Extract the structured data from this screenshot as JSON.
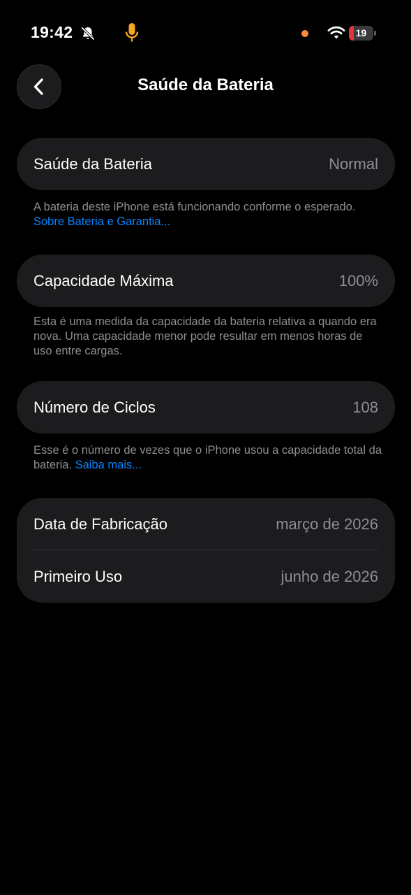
{
  "status_bar": {
    "time": "19:42",
    "battery_level": "19",
    "battery_fraction": 0.19,
    "colors": {
      "mic": "#f5a623",
      "dot": "#ff8a3d",
      "battery_low": "#e0353b"
    },
    "icons": [
      "bell-slash-icon",
      "microphone-icon",
      "wifi-icon",
      "battery-icon"
    ]
  },
  "nav": {
    "title": "Saúde da Bateria",
    "back_icon": "chevron-left-icon"
  },
  "health": {
    "label": "Saúde da Bateria",
    "value": "Normal",
    "footnote_text": "A bateria deste iPhone está funcionando conforme o esperado. ",
    "footnote_link": "Sobre Bateria e Garantia..."
  },
  "capacity": {
    "label": "Capacidade Máxima",
    "value": "100%",
    "footnote_text": "Esta é uma medida da capacidade da bateria relativa a quando era nova. Uma capacidade menor pode resultar em menos horas de uso entre cargas."
  },
  "cycles": {
    "label": "Número de Ciclos",
    "value": "108",
    "footnote_text": "Esse é o número de vezes que o iPhone usou a capacidade total da bateria. ",
    "footnote_link": "Saiba mais..."
  },
  "dates": {
    "manufacture_label": "Data de Fabricação",
    "manufacture_value": "março de 2026",
    "first_use_label": "Primeiro Uso",
    "first_use_value": "junho de 2026"
  },
  "colors": {
    "background": "#000000",
    "card": "#1c1c1e",
    "secondary_text": "#8e8e93",
    "link": "#0a84ff"
  }
}
